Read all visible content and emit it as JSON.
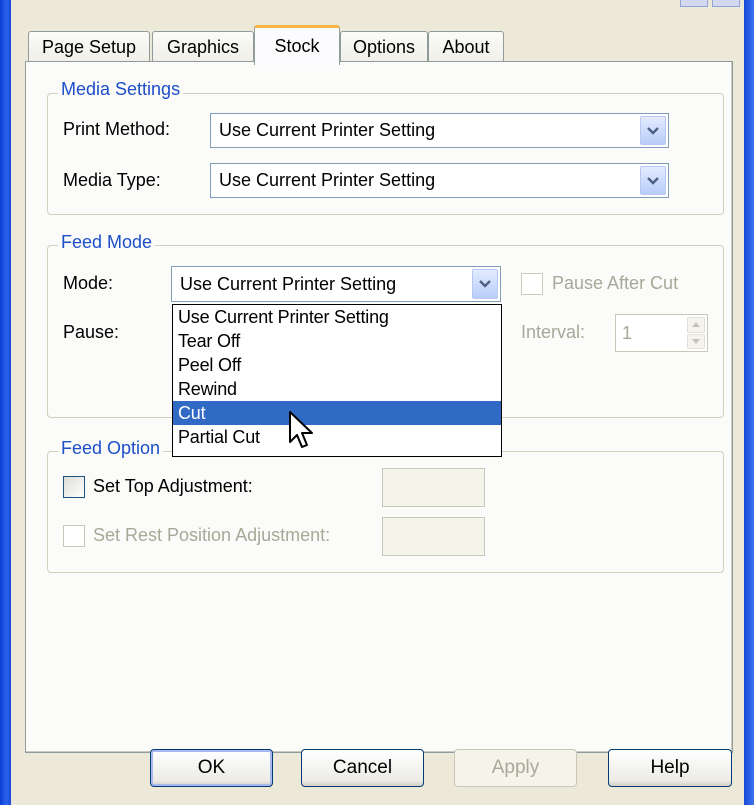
{
  "tabs": [
    {
      "label": "Page Setup"
    },
    {
      "label": "Graphics"
    },
    {
      "label": "Stock"
    },
    {
      "label": "Options"
    },
    {
      "label": "About"
    }
  ],
  "media_settings": {
    "title": "Media Settings",
    "print_method_label": "Print Method:",
    "print_method_value": "Use Current Printer Setting",
    "media_type_label": "Media Type:",
    "media_type_value": "Use Current Printer Setting"
  },
  "feed_mode": {
    "title": "Feed Mode",
    "mode_label": "Mode:",
    "mode_value": "Use Current Printer Setting",
    "pause_label": "Pause:",
    "pause_after_cut_label": "Pause After Cut",
    "interval_label": "Interval:",
    "interval_value": "1",
    "dropdown_options": [
      "Use Current Printer Setting",
      "Tear Off",
      "Peel Off",
      "Rewind",
      "Cut",
      "Partial Cut"
    ],
    "highlighted_option": "Cut"
  },
  "feed_options": {
    "title": "Feed Option",
    "set_top_adjustment_label": "Set Top Adjustment:",
    "set_rest_position_label": "Set Rest Position Adjustment:"
  },
  "buttons": {
    "ok": "OK",
    "cancel": "Cancel",
    "apply": "Apply",
    "help": "Help"
  }
}
